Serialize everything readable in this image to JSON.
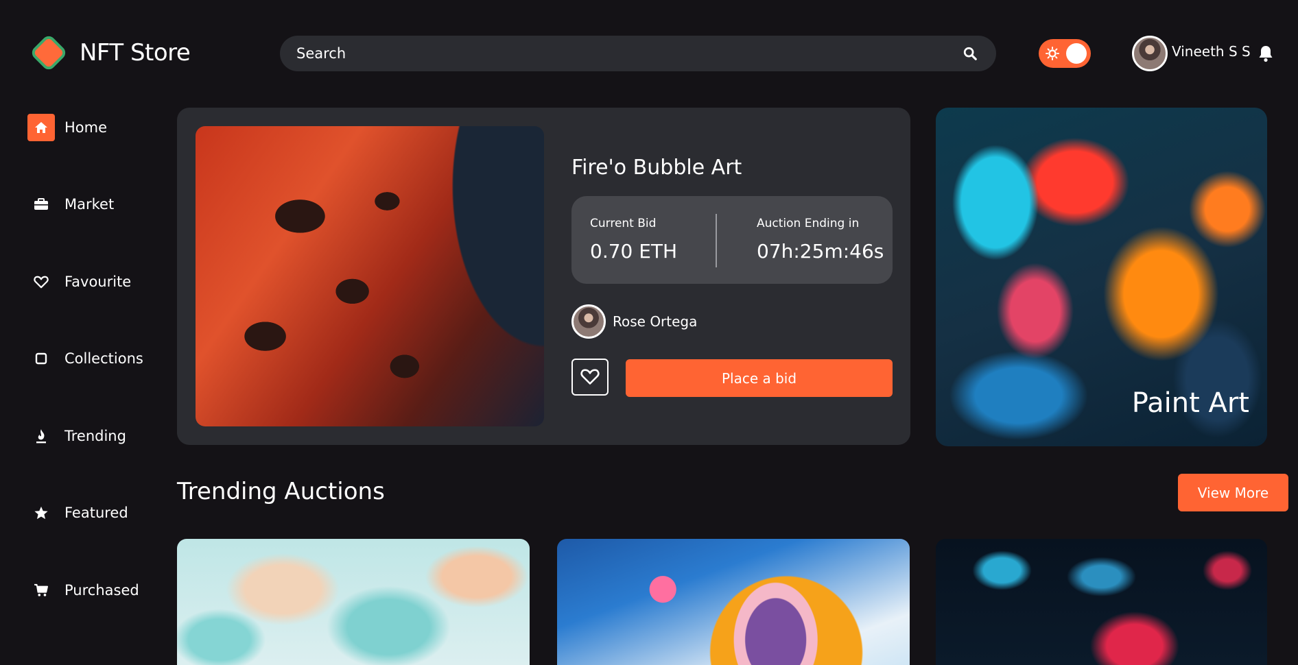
{
  "header": {
    "logo_text": "NFT Store",
    "search_placeholder": "Search",
    "username": "Vineeth S S"
  },
  "sidebar": {
    "items": [
      {
        "label": "Home",
        "icon": "home-icon",
        "active": true
      },
      {
        "label": "Market",
        "icon": "briefcase-icon"
      },
      {
        "label": "Favourite",
        "icon": "heart-icon"
      },
      {
        "label": "Collections",
        "icon": "square-icon"
      },
      {
        "label": "Trending",
        "icon": "fire-icon"
      },
      {
        "label": "Featured",
        "icon": "star-icon"
      },
      {
        "label": "Purchased",
        "icon": "cart-icon"
      }
    ]
  },
  "hero": {
    "title": "Fire'o Bubble Art",
    "current_bid_label": "Current Bid",
    "current_bid_value": "0.70 ETH",
    "auction_label": "Auction Ending in",
    "auction_value": "07h:25m:46s",
    "owner_name": "Rose Ortega",
    "bid_button": "Place a bid"
  },
  "side_art": {
    "title": "Paint Art"
  },
  "trending": {
    "title": "Trending Auctions",
    "view_more": "View More"
  },
  "colors": {
    "accent": "#ff6433",
    "background": "#141216",
    "card": "#2b2c31"
  }
}
